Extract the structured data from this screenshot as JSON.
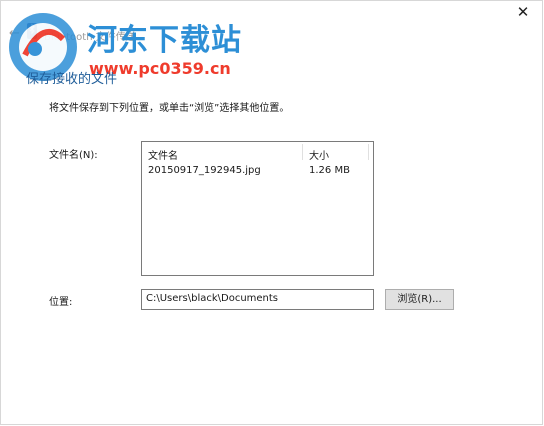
{
  "window": {
    "title": "Bluetooth 文件传送",
    "close_glyph": "✕",
    "back_glyph": "←"
  },
  "watermark": {
    "title": "河东下载站",
    "url": "www.pc0359.cn"
  },
  "page": {
    "heading": "保存接收的文件",
    "instruction": "将文件保存到下列位置，或单击“浏览”选择其他位置。"
  },
  "files": {
    "label": "文件名(N):",
    "columns": {
      "name": "文件名",
      "size": "大小"
    },
    "rows": [
      {
        "name": "20150917_192945.jpg",
        "size": "1.26 MB"
      }
    ]
  },
  "location": {
    "label": "位置:",
    "value": "C:\\Users\\black\\Documents",
    "browse_label": "浏览(R)..."
  },
  "colors": {
    "heading": "#1f5d99",
    "watermark_blue": "#2d8fd6",
    "watermark_red": "#ef3b2c",
    "bluetooth_icon": "#2a4f9e"
  }
}
